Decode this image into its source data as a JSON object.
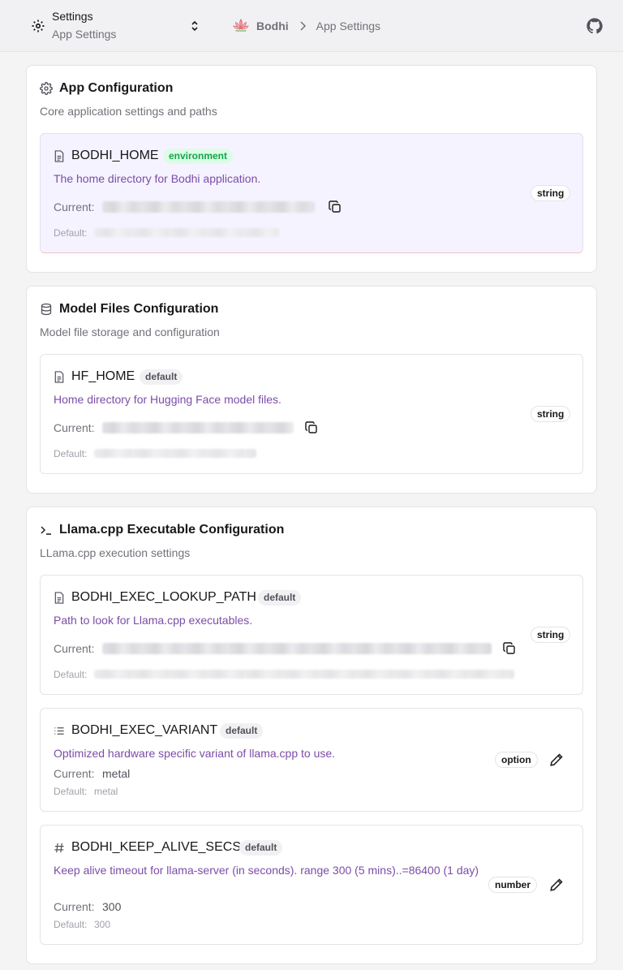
{
  "header": {
    "selector_title": "Settings",
    "selector_subtitle": "App Settings",
    "breadcrumb_root": "Bodhi",
    "breadcrumb_current": "App Settings"
  },
  "sections": [
    {
      "title": "App Configuration",
      "description": "Core application settings and paths",
      "icon": "gear-icon",
      "settings": [
        {
          "name": "BODHI_HOME",
          "source": "environment",
          "description": "The home directory for Bodhi application.",
          "current_label": "Current:",
          "default_label": "Default:",
          "type": "string",
          "icon": "file-icon"
        }
      ]
    },
    {
      "title": "Model Files Configuration",
      "description": "Model file storage and configuration",
      "icon": "database-icon",
      "settings": [
        {
          "name": "HF_HOME",
          "source": "default",
          "description": "Home directory for Hugging Face model files.",
          "current_label": "Current:",
          "default_label": "Default:",
          "type": "string",
          "icon": "file-icon"
        }
      ]
    },
    {
      "title": "Llama.cpp Executable Configuration",
      "description": "LLama.cpp execution settings",
      "icon": "terminal-icon",
      "settings": [
        {
          "name": "BODHI_EXEC_LOOKUP_PATH",
          "source": "default",
          "description": "Path to look for Llama.cpp executables.",
          "current_label": "Current:",
          "default_label": "Default:",
          "type": "string",
          "icon": "file-icon"
        },
        {
          "name": "BODHI_EXEC_VARIANT",
          "source": "default",
          "description": "Optimized hardware specific variant of llama.cpp to use.",
          "current_label": "Current:",
          "current_value": "metal",
          "default_label": "Default:",
          "default_value": "metal",
          "type": "option",
          "icon": "list-icon"
        },
        {
          "name": "BODHI_KEEP_ALIVE_SECS",
          "source": "default",
          "description": "Keep alive timeout for llama-server (in seconds). range 300 (5 mins)..=86400 (1 day)",
          "current_label": "Current:",
          "current_value": "300",
          "default_label": "Default:",
          "default_value": "300",
          "type": "number",
          "icon": "hash-icon"
        }
      ]
    }
  ],
  "colors": {
    "accent_text": "#7c4ca8",
    "env_badge": "#16a34a",
    "highlight_bg": "#f5f3ff"
  }
}
